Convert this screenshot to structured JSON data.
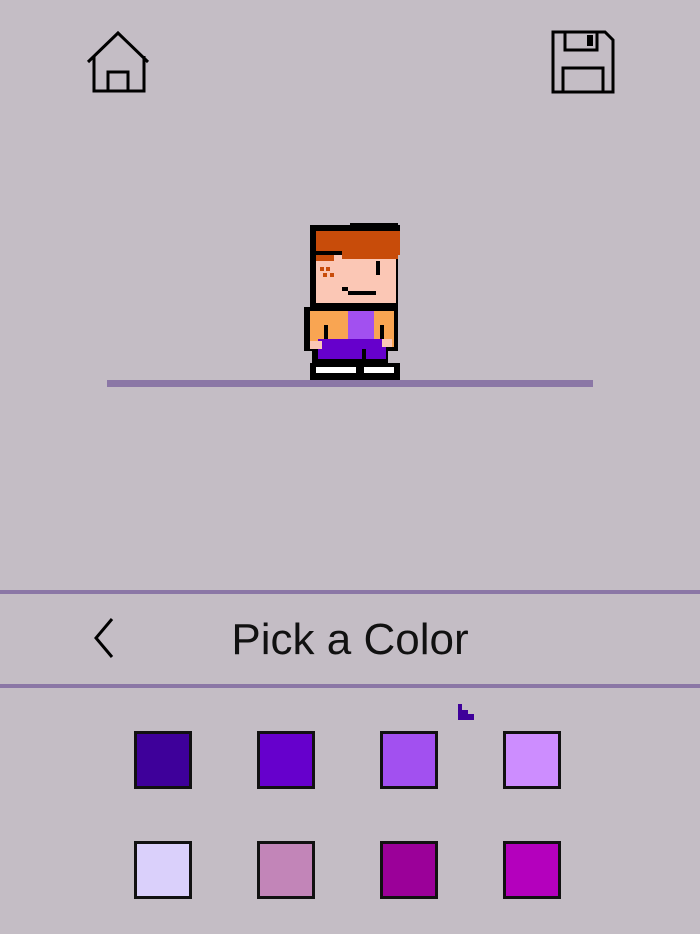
{
  "header": {
    "home_icon": "home-icon",
    "save_icon": "floppy-disk-icon"
  },
  "picker": {
    "title": "Pick a Color",
    "back_icon": "chevron-left-icon"
  },
  "palette": [
    {
      "color": "#3e009a"
    },
    {
      "color": "#6600cc"
    },
    {
      "color": "#a250f0"
    },
    {
      "color": "#cd8dff"
    },
    {
      "color": "#dad0fb"
    },
    {
      "color": "#c285b8"
    },
    {
      "color": "#9b0099"
    },
    {
      "color": "#b400bd"
    }
  ],
  "colors": {
    "background": "#c4bdc5",
    "accent_line": "#8b77a6",
    "hair": "#c84c0a",
    "skin": "#fbc7b5",
    "jacket": "#f9a552",
    "shirt": "#a250f0",
    "pants": "#6600cc",
    "outline": "#000000"
  }
}
